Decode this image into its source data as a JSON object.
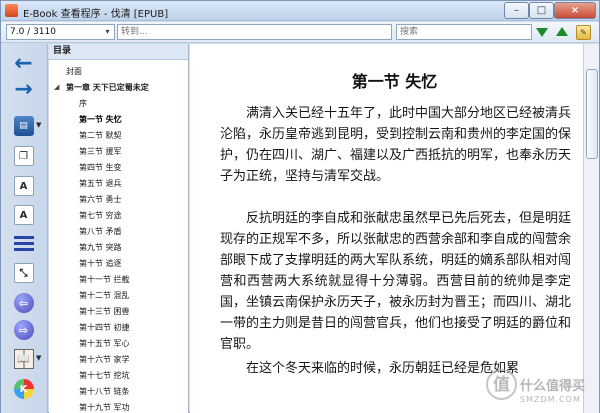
{
  "window": {
    "title": "E-Book 查看程序 - 伐清 [EPUB]",
    "min_label": "–",
    "max_label": "□",
    "close_label": "×"
  },
  "toolbar": {
    "page_value": "7.0 / 3110",
    "goto_placeholder": "转到...",
    "search_placeholder": "搜索",
    "highlight_label": "✎"
  },
  "sidebar": {
    "icons": [
      {
        "name": "back-arrow-icon",
        "label": "←"
      },
      {
        "name": "forward-arrow-icon",
        "label": "→"
      },
      {
        "name": "print-icon",
        "label": "▤"
      },
      {
        "name": "copy-icon",
        "label": "❐"
      },
      {
        "name": "font-increase-icon",
        "label": "A"
      },
      {
        "name": "font-decrease-icon",
        "label": "A"
      },
      {
        "name": "line-spacing-icon",
        "label": ""
      },
      {
        "name": "fit-icon",
        "label": "⤡"
      },
      {
        "name": "previous-chapter-icon",
        "label": "⇦"
      },
      {
        "name": "next-chapter-icon",
        "label": "⇨"
      },
      {
        "name": "book-settings-icon",
        "label": "📖"
      },
      {
        "name": "color-theme-icon",
        "label": "K"
      }
    ]
  },
  "toc": {
    "title": "目录",
    "items": [
      "封面",
      "第一章 天下已定蜀未定",
      "序",
      "第一节 失忆",
      "第二节 默契",
      "第三节 援军",
      "第四节 生变",
      "第五节 退兵",
      "第六节 勇士",
      "第七节 穷途",
      "第八节 矛盾",
      "第九节 突路",
      "第十节 追逐",
      "第十一节 拦截",
      "第十二节 混乱",
      "第十三节 困兽",
      "第十四节 初捷",
      "第十五节 军心",
      "第十六节 家学",
      "第十七节 挖坑",
      "第十八节 链条",
      "第十九节 军功"
    ]
  },
  "reader": {
    "chapter_title": "第一节 失忆",
    "paragraphs": [
      "满清入关已经十五年了，此时中国大部分地区已经被清兵沦陷，永历皇帝逃到昆明，受到控制云南和贵州的李定国的保护，仍在四川、湖广、福建以及广西抵抗的明军，也奉永历天子为正统，坚持与清军交战。",
      "反抗明廷的李自成和张献忠虽然早已先后死去，但是明廷现存的正规军不多，所以张献忠的西营余部和李自成的闯营余部眼下成了支撑明廷的两大军队系统，明廷的嫡系部队相对闯营和西营两大系统就显得十分薄弱。西营目前的统帅是李定国，坐镇云南保护永历天子，被永历封为晋王；而四川、湖北一带的主力则是昔日的闯营官兵，他们也接受了明廷的爵位和官职。",
      "在这个冬天来临的时候，永历朝廷已经是危如累"
    ]
  },
  "watermark": {
    "glyph": "值",
    "text": "什么值得买",
    "subtext": "SMZDM.COM"
  },
  "colors": {
    "accent_green": "#198d27",
    "window_blue": "#cfdcec"
  }
}
